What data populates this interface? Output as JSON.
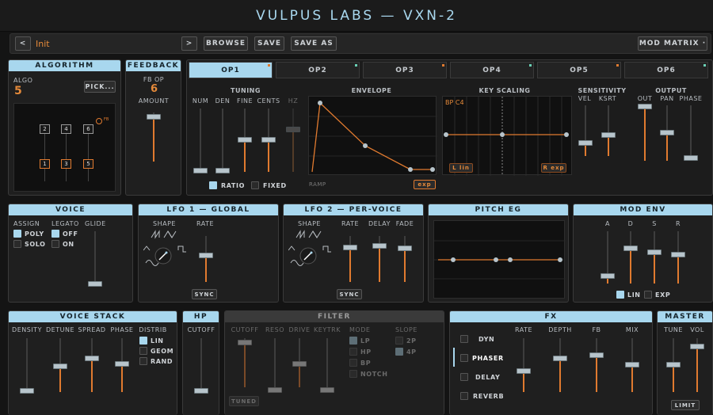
{
  "title": "VULPUS LABS — VXN-2",
  "toolbar": {
    "prev": "<",
    "preset": "Init",
    "next": ">",
    "browse": "BROWSE",
    "save": "SAVE",
    "save_as": "SAVE AS",
    "mod_matrix": "MOD MATRIX ·"
  },
  "algorithm": {
    "title": "ALGORITHM",
    "algo_label": "ALGO",
    "algo_value": "5",
    "pick": "PICK...",
    "ops_top": [
      "2",
      "4",
      "6"
    ],
    "ops_bottom": [
      "1",
      "3",
      "5"
    ],
    "fb_mark": "FB"
  },
  "feedback": {
    "title": "FEEDBACK",
    "fb_op": "FB OP",
    "value": "6",
    "amount": "AMOUNT"
  },
  "op_tabs": [
    "OP1",
    "OP2",
    "OP3",
    "OP4",
    "OP5",
    "OP6"
  ],
  "tuning": {
    "title": "TUNING",
    "labels": [
      "NUM",
      "DEN",
      "FINE",
      "CENTS",
      "HZ"
    ],
    "ratio": "RATIO",
    "fixed": "FIXED"
  },
  "envelope": {
    "title": "ENVELOPE",
    "ramp": "RAMP",
    "exp": "exp"
  },
  "key_scaling": {
    "title": "KEY SCALING",
    "bp": "BP C4",
    "left": "L lin",
    "right": "R exp"
  },
  "sensitivity": {
    "title": "SENSITIVITY",
    "labels": [
      "VEL",
      "KSRT"
    ]
  },
  "output": {
    "title": "OUTPUT",
    "labels": [
      "OUT",
      "PAN",
      "PHASE"
    ]
  },
  "voice": {
    "title": "VOICE",
    "assign": "ASSIGN",
    "legato": "LEGATO",
    "glide": "GLIDE",
    "poly": "POLY",
    "solo": "SOLO",
    "off": "OFF",
    "on": "ON"
  },
  "lfo1": {
    "title": "LFO 1 — GLOBAL",
    "shape": "SHAPE",
    "rate": "RATE",
    "sync": "SYNC"
  },
  "lfo2": {
    "title": "LFO 2 — PER-VOICE",
    "shape": "SHAPE",
    "labels": [
      "RATE",
      "DELAY",
      "FADE"
    ],
    "sync": "SYNC"
  },
  "pitch_eg": {
    "title": "PITCH EG"
  },
  "mod_env": {
    "title": "MOD ENV",
    "labels": [
      "A",
      "D",
      "S",
      "R"
    ],
    "lin": "LIN",
    "exp": "EXP"
  },
  "voice_stack": {
    "title": "VOICE STACK",
    "labels": [
      "DENSITY",
      "DETUNE",
      "SPREAD",
      "PHASE"
    ],
    "distrib": "DISTRIB",
    "opts": [
      "LIN",
      "GEOM",
      "RAND"
    ]
  },
  "hp": {
    "title": "HP",
    "cutoff": "CUTOFF"
  },
  "filter": {
    "title": "FILTER",
    "labels": [
      "CUTOFF",
      "RESO",
      "DRIVE",
      "KEYTRK"
    ],
    "mode": "MODE",
    "modes": [
      "LP",
      "HP",
      "BP",
      "NOTCH"
    ],
    "slope": "SLOPE",
    "slopes": [
      "2P",
      "4P"
    ],
    "tuned": "TUNED"
  },
  "fx": {
    "title": "FX",
    "items": [
      "DYN",
      "PHASER",
      "DELAY",
      "REVERB"
    ],
    "labels": [
      "RATE",
      "DEPTH",
      "FB",
      "MIX"
    ]
  },
  "master": {
    "title": "MASTER",
    "labels": [
      "TUNE",
      "VOL"
    ],
    "limit": "LIMIT"
  },
  "colors": {
    "accent": "#a8d7ee",
    "orange": "#e07a2f",
    "bg": "#141414"
  }
}
